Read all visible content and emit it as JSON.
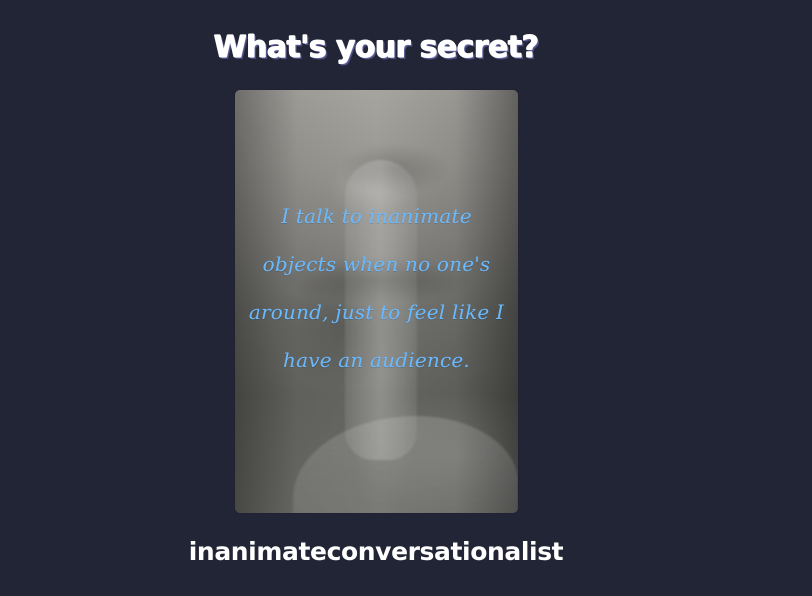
{
  "page": {
    "title": "What's your secret?"
  },
  "card": {
    "image_subject": "hushing-gesture-photo",
    "secret_text": "I talk to inanimate objects when no one's around, just to feel like I have an audience."
  },
  "footer": {
    "username": "inanimateconversationalist"
  },
  "colors": {
    "background": "#222535",
    "title": "#ffffff",
    "secret_text": "#69b9ff"
  }
}
